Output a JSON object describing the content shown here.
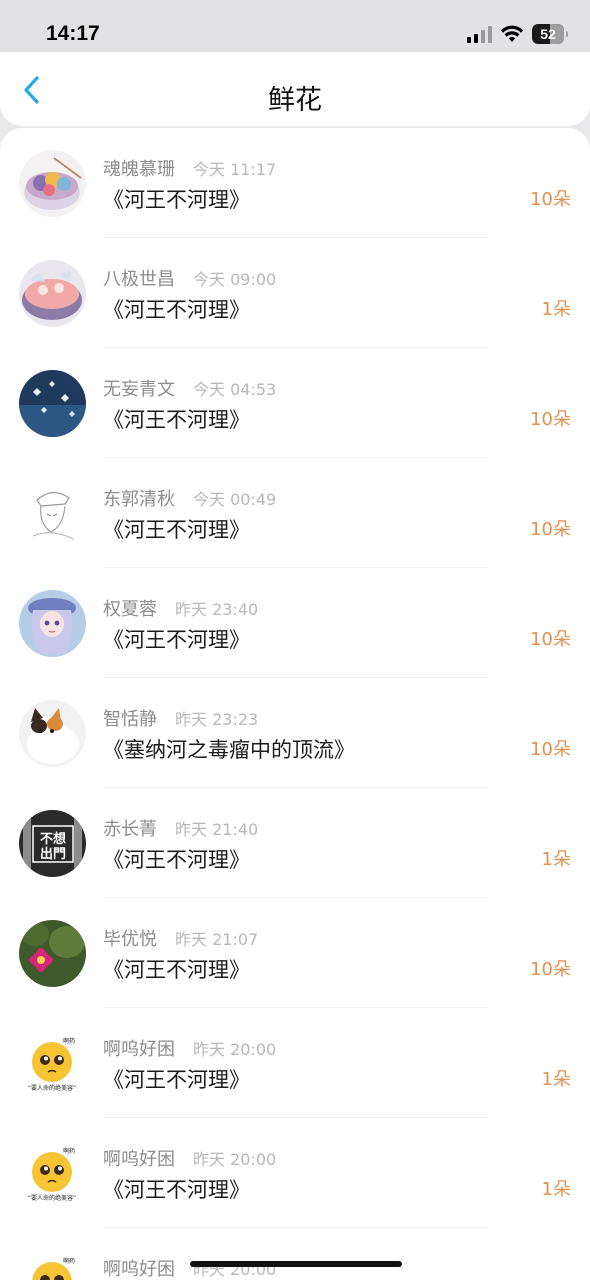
{
  "status_bar": {
    "time": "14:17",
    "battery": "52"
  },
  "nav": {
    "title": "鲜花",
    "back_icon": "chevron-left-icon",
    "accent": "#2aa8e4"
  },
  "rows": [
    {
      "user": "魂魄慕珊",
      "time": "今天 11:17",
      "title": "《河王不河理》",
      "count": "10朵",
      "avatar": "food-bowl"
    },
    {
      "user": "八极世昌",
      "time": "今天 09:00",
      "title": "《河王不河理》",
      "count": "1朵",
      "avatar": "food-bowl-2"
    },
    {
      "user": "无妄青文",
      "time": "今天 04:53",
      "title": "《河王不河理》",
      "count": "10朵",
      "avatar": "blue-night"
    },
    {
      "user": "东郭清秋",
      "time": "今天 00:49",
      "title": "《河王不河理》",
      "count": "10朵",
      "avatar": "sketch"
    },
    {
      "user": "权夏蓉",
      "time": "昨天 23:40",
      "title": "《河王不河理》",
      "count": "10朵",
      "avatar": "anime-girl"
    },
    {
      "user": "智恬静",
      "time": "昨天 23:23",
      "title": "《塞纳河之毒瘤中的顶流》",
      "count": "10朵",
      "avatar": "cat"
    },
    {
      "user": "赤长菁",
      "time": "昨天 21:40",
      "title": "《河王不河理》",
      "count": "1朵",
      "avatar": "text-bw",
      "avatar_text": [
        "不想",
        "出門"
      ]
    },
    {
      "user": "毕优悦",
      "time": "昨天 21:07",
      "title": "《河王不河理》",
      "count": "10朵",
      "avatar": "cactus-flower"
    },
    {
      "user": "啊呜好困",
      "time": "昨天 20:00",
      "title": "《河王不河理》",
      "count": "1朵",
      "avatar": "emoji",
      "avatar_text": [
        "啊药",
        "“要人命的绝美容”"
      ]
    },
    {
      "user": "啊呜好困",
      "time": "昨天 20:00",
      "title": "《河王不河理》",
      "count": "1朵",
      "avatar": "emoji",
      "avatar_text": [
        "啊药",
        "“要人命的绝美容”"
      ]
    },
    {
      "user": "啊呜好困",
      "time": "昨天 20:00",
      "title": "",
      "count": "",
      "avatar": "emoji",
      "avatar_text": [
        "啊药",
        ""
      ]
    }
  ],
  "colors": {
    "count": "#e0914f",
    "username": "#8d8d8d",
    "timestamp": "#b8b8b8"
  }
}
